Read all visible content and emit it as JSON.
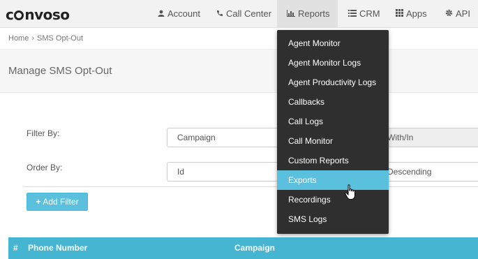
{
  "brand": {
    "logo_text_a": "c",
    "logo_text_b": "nvoso"
  },
  "nav": {
    "account": "Account",
    "call_center": "Call Center",
    "reports": "Reports",
    "crm": "CRM",
    "apps": "Apps",
    "api": "API"
  },
  "breadcrumb": {
    "home": "Home",
    "sep": "›",
    "current": "SMS Opt-Out"
  },
  "page": {
    "title": "Manage SMS Opt-Out"
  },
  "filters": {
    "filter_by_label": "Filter By:",
    "filter_field": "Campaign",
    "filter_operator": "With/In",
    "order_by_label": "Order By:",
    "order_field": "Id",
    "order_direction": "Descending",
    "add_filter_label": "Add Filter"
  },
  "table": {
    "columns": [
      "#",
      "Phone Number",
      "Campaign"
    ]
  },
  "reports_menu": {
    "items": [
      "Agent Monitor",
      "Agent Monitor Logs",
      "Agent Productivity Logs",
      "Callbacks",
      "Call Logs",
      "Call Monitor",
      "Custom Reports",
      "Exports",
      "Recordings",
      "SMS Logs"
    ],
    "hovered_index": 7
  },
  "colors": {
    "accent": "#5bc0de",
    "table_header": "#45b5d2",
    "menu_bg": "#2f2f2f"
  }
}
